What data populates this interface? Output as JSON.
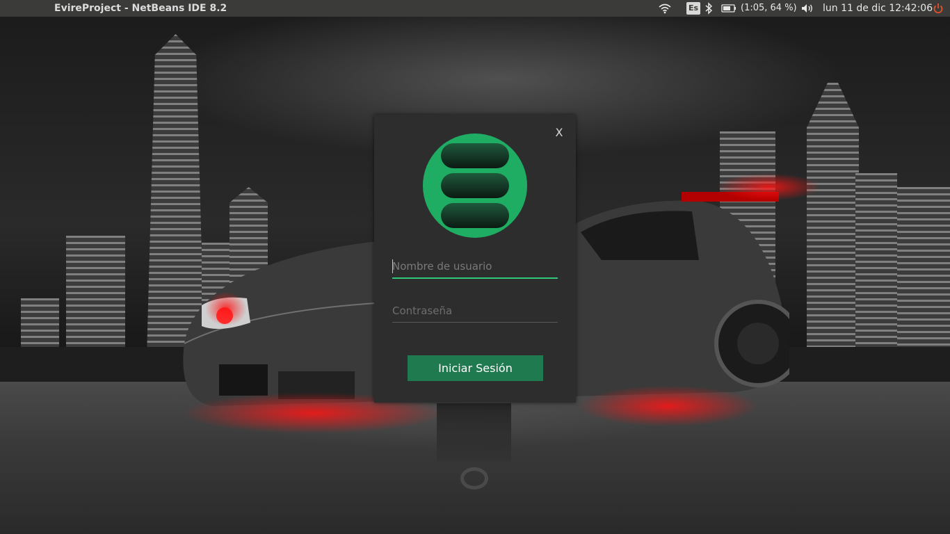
{
  "panel": {
    "app_title": "EvireProject - NetBeans IDE 8.2",
    "keyboard_layout": "Es",
    "battery_status": "(1:05, 64 %)",
    "battery_level_percent": 64,
    "clock": "lun 11 de dic 12:42:06",
    "icons": [
      "wifi-icon",
      "keyboard-layout-indicator",
      "bluetooth-icon",
      "battery-icon",
      "volume-icon",
      "power-icon"
    ]
  },
  "dialog": {
    "close_label": "X",
    "logo_color": "#1fad64",
    "username_placeholder": "Nombre de usuario",
    "username_value": "",
    "password_placeholder": "Contraseña",
    "password_value": "",
    "login_label": "Iniciar Sesión",
    "accent_color": "#2fc97a",
    "button_color": "#1f7a4f"
  }
}
